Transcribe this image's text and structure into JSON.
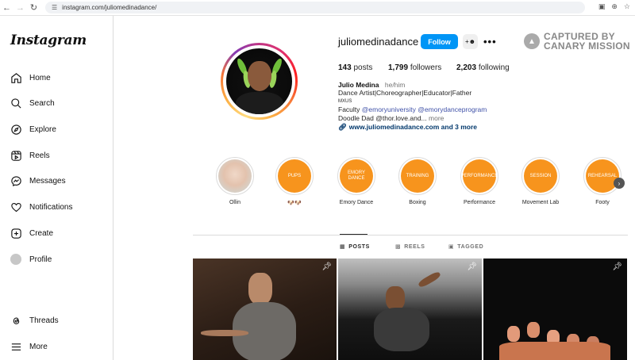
{
  "browser": {
    "url": "instagram.com/juliomedinadance/"
  },
  "sidebar": {
    "logo": "Instagram",
    "items": [
      {
        "label": "Home",
        "icon": "home-icon"
      },
      {
        "label": "Search",
        "icon": "search-icon"
      },
      {
        "label": "Explore",
        "icon": "compass-icon"
      },
      {
        "label": "Reels",
        "icon": "reels-icon"
      },
      {
        "label": "Messages",
        "icon": "messenger-icon"
      },
      {
        "label": "Notifications",
        "icon": "heart-icon"
      },
      {
        "label": "Create",
        "icon": "plus-square-icon"
      },
      {
        "label": "Profile",
        "icon": "profile-avatar-icon"
      },
      {
        "label": "Threads",
        "icon": "threads-icon"
      },
      {
        "label": "More",
        "icon": "hamburger-icon"
      }
    ]
  },
  "profile": {
    "username": "juliomedinadance",
    "follow_label": "Follow",
    "stats": {
      "posts_num": "143",
      "posts_label": "posts",
      "followers_num": "1,799",
      "followers_label": "followers",
      "following_num": "2,203",
      "following_label": "following"
    },
    "bio": {
      "name": "Julio Medina",
      "pronouns": "he/him",
      "line1": "Dance Artist|Choreographer|Educator|Father",
      "line2": "MXUS",
      "line3_prefix": "Faculty ",
      "mention1": "@emoryuniversity",
      "mention2": "@emorydanceprogram",
      "line4": "Doodle Dad @thor.love.and...",
      "more": "more",
      "link": "www.juliomedinadance.com and 3 more"
    }
  },
  "watermark": {
    "line1": "CAPTURED BY",
    "line2": "CANARY MISSION"
  },
  "highlights": [
    {
      "cover": "",
      "label": "Ollin"
    },
    {
      "cover": "PUPS",
      "label": "🐶🐶"
    },
    {
      "cover": "EMORY DANCE",
      "label": "Emory Dance"
    },
    {
      "cover": "TRAINING",
      "label": "Boxing"
    },
    {
      "cover": "PERFORMANCE",
      "label": "Performance"
    },
    {
      "cover": "SESSION",
      "label": "Movement Lab"
    },
    {
      "cover": "REHEARSAL",
      "label": "Footy"
    }
  ],
  "tabs": [
    {
      "label": "POSTS",
      "icon": "grid-icon"
    },
    {
      "label": "REELS",
      "icon": "reels-icon"
    },
    {
      "label": "TAGGED",
      "icon": "tagged-icon"
    }
  ],
  "colors": {
    "accent": "#0095f6",
    "highlight_cover": "#f7941d",
    "link": "#00376b",
    "mention": "#4052a8"
  }
}
